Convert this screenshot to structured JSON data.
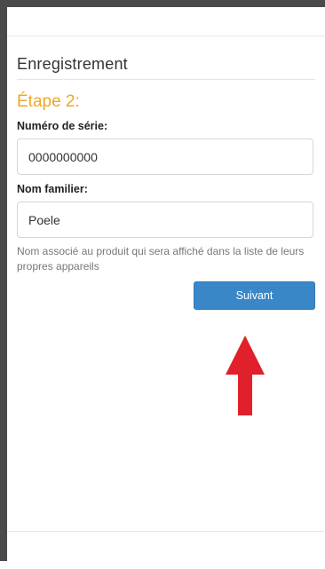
{
  "page": {
    "section_title": "Enregistrement",
    "step_title": "Étape 2:"
  },
  "form": {
    "serial": {
      "label": "Numéro de série:",
      "value": "0000000000"
    },
    "nickname": {
      "label": "Nom familier:",
      "value": "Poele",
      "help": "Nom associé au produit qui sera affiché dans la liste de leurs propres appareils"
    },
    "next_label": "Suivant"
  },
  "colors": {
    "step_title": "#f0a623",
    "button": "#3a87c8",
    "arrow": "#e0202a"
  },
  "annotation": {
    "icon": "arrow-up-icon"
  }
}
